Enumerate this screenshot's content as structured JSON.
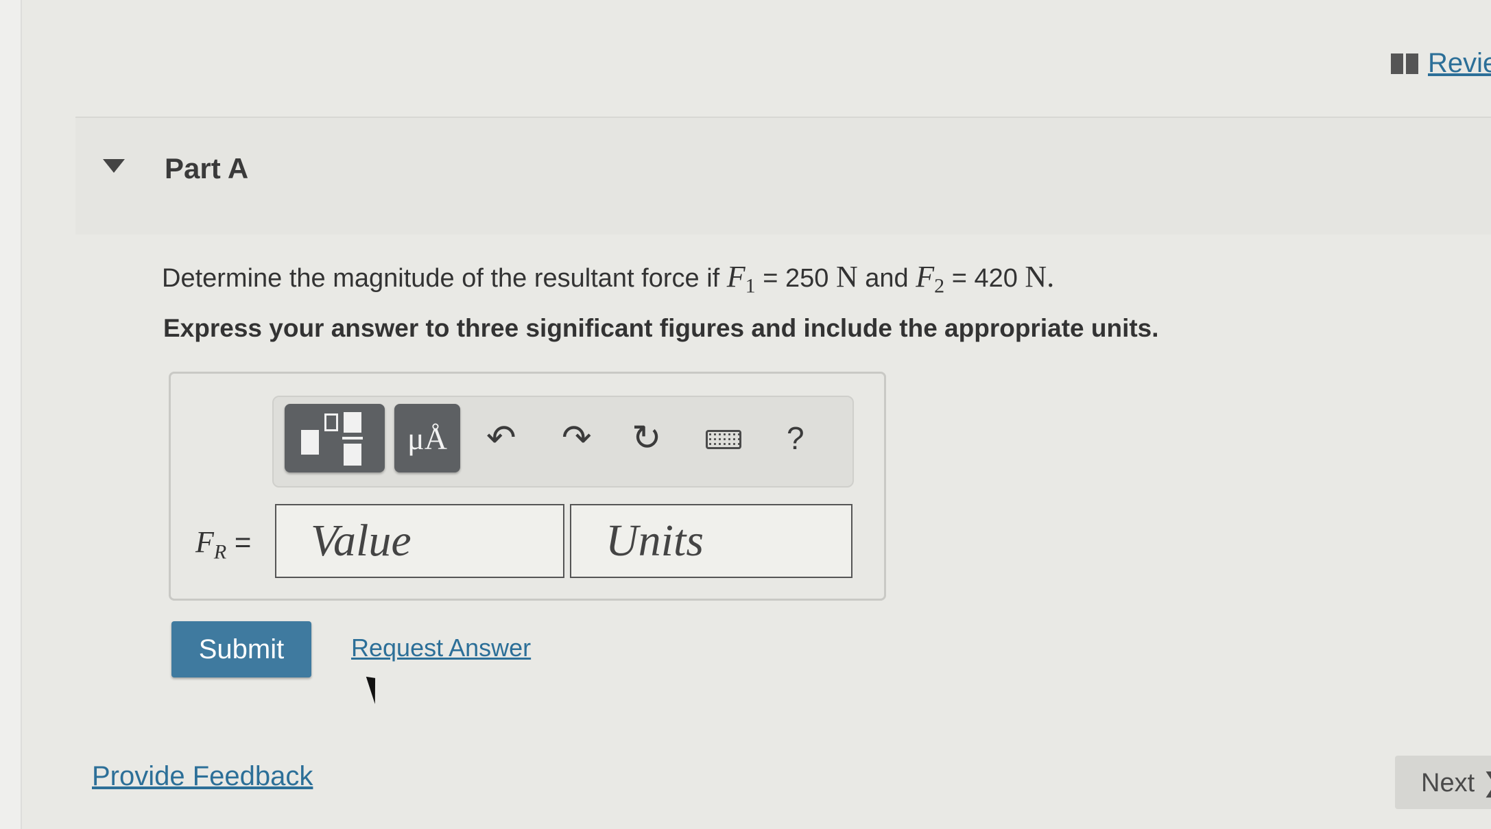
{
  "header": {
    "review_label": "Revie"
  },
  "part": {
    "title": "Part A"
  },
  "question": {
    "prefix": "Determine the magnitude of the resultant force if ",
    "f1_symbol": "F",
    "f1_sub": "1",
    "f1_eq": " = 250 ",
    "f1_unit": "N",
    "conj": " and ",
    "f2_symbol": "F",
    "f2_sub": "2",
    "f2_eq": " = 420 ",
    "f2_unit": "N",
    "end": ".",
    "instruction": "Express your answer to three significant figures and include the appropriate units."
  },
  "answer": {
    "variable_symbol": "F",
    "variable_sub": "R",
    "equals": " =",
    "value_placeholder": "Value",
    "units_placeholder": "Units"
  },
  "toolbar": {
    "units_button_label": "μÅ",
    "undo_glyph": "↶",
    "redo_glyph": "↷",
    "reset_glyph": "↻",
    "help_label": "?"
  },
  "actions": {
    "submit_label": "Submit",
    "request_answer_label": "Request Answer",
    "feedback_label": "Provide Feedback",
    "next_label": "Next ❯"
  },
  "colors": {
    "accent": "#3f7a9f",
    "link": "#2c6f98",
    "toolbar_button": "#5d6063"
  },
  "icons": [
    "book-icon",
    "caret-down-icon",
    "templates-icon",
    "undo-icon",
    "redo-icon",
    "reset-icon",
    "keyboard-icon",
    "help-icon",
    "cursor-icon"
  ]
}
